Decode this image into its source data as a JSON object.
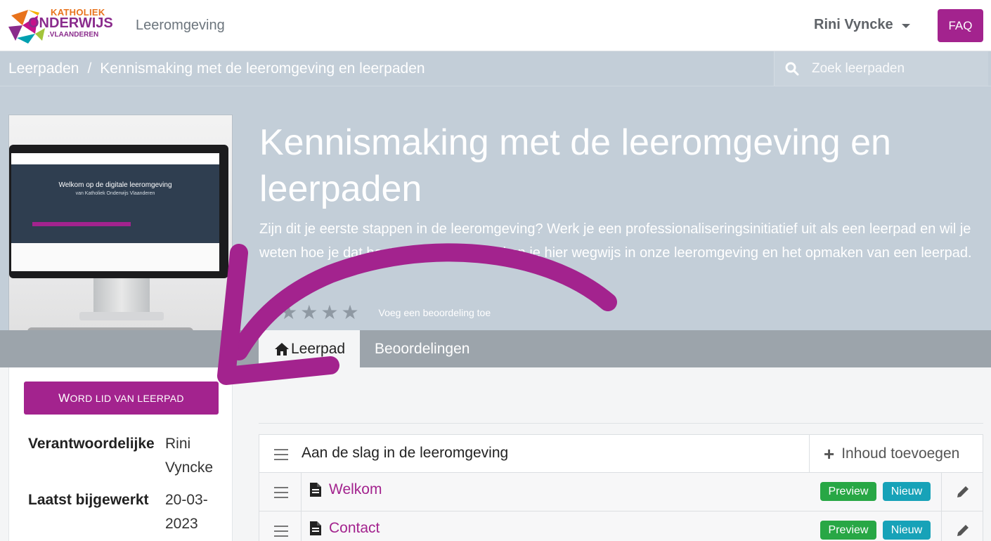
{
  "brand": {
    "logo_line1": "KATHOLIEK",
    "logo_line2": "ONDERWIJS",
    "logo_line3": ".VLAANDEREN",
    "accent_color": "#a3238e"
  },
  "navbar": {
    "title": "Leeromgeving",
    "user_name": "Rini Vyncke",
    "faq_label": "FAQ"
  },
  "breadcrumb": {
    "root": "Leerpaden",
    "separator": "/",
    "current": "Kennismaking met de leeromgeving en leerpaden"
  },
  "search": {
    "placeholder": "Zoek leerpaden"
  },
  "hero": {
    "title": "Kennismaking met de leeromgeving en leerpaden",
    "description": "Zijn dit je eerste stappen in de leeromgeving? Werk je een professionaliseringsinitiatief uit als een leerpad en wil je weten hoe je dat best aanpakt? We maken je hier wegwijs in onze leeromgeving en het opmaken van een leerpad.",
    "rating_stars": 0,
    "rating_label": "Voeg een beoordeling toe",
    "image_screen_title": "Welkom op de digitale leeromgeving",
    "image_screen_subtitle": "van Katholiek Onderwijs Vlaanderen"
  },
  "tabs": [
    {
      "label": "Leerpad",
      "icon": "home-icon",
      "active": true
    },
    {
      "label": "Beoordelingen",
      "active": false
    }
  ],
  "sidebar": {
    "join_button_first": "W",
    "join_button_rest": "ORD LID VAN LEERPAD",
    "meta": [
      {
        "label": "Verantwoordelijke",
        "value": "Rini Vyncke"
      },
      {
        "label": "Laatst bijgewerkt",
        "value": "20-03-2023"
      }
    ]
  },
  "content": {
    "section_title": "Aan de slag in de leeromgeving",
    "add_content_label": "Inhoud toevoegen",
    "items": [
      {
        "title": "Welkom",
        "badge_preview": "Preview",
        "badge_new": "Nieuw"
      },
      {
        "title": "Contact",
        "badge_preview": "Preview",
        "badge_new": "Nieuw"
      }
    ]
  }
}
